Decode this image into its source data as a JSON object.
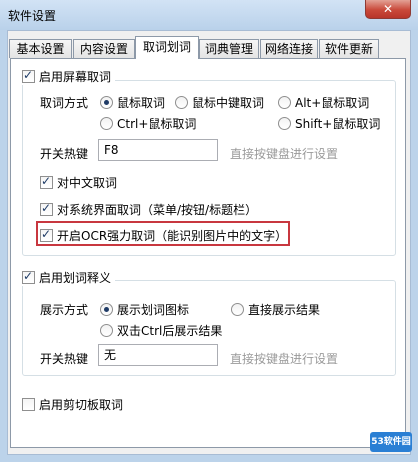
{
  "window": {
    "title": "软件设置",
    "close_glyph": "✕"
  },
  "tabs": [
    {
      "label": "基本设置"
    },
    {
      "label": "内容设置"
    },
    {
      "label": "取词划词"
    },
    {
      "label": "词典管理"
    },
    {
      "label": "网络连接"
    },
    {
      "label": "软件更新"
    }
  ],
  "screen_capture": {
    "enable_label": "启用屏幕取词",
    "method_label": "取词方式",
    "options": [
      {
        "label": "鼠标取词",
        "selected": true
      },
      {
        "label": "鼠标中键取词",
        "selected": false
      },
      {
        "label": "Alt+鼠标取词",
        "selected": false
      },
      {
        "label": "Ctrl+鼠标取词",
        "selected": false
      },
      {
        "label": "Shift+鼠标取词",
        "selected": false
      }
    ],
    "hotkey_label": "开关热键",
    "hotkey_value": "F8",
    "hotkey_hint": "直接按键盘进行设置",
    "chinese_label": "对中文取词",
    "system_ui_label": "对系统界面取词（菜单/按钮/标题栏）",
    "ocr_label": "开启OCR强力取词（能识别图片中的文字）"
  },
  "selection": {
    "enable_label": "启用划词释义",
    "method_label": "展示方式",
    "options": [
      {
        "label": "展示划词图标",
        "selected": true
      },
      {
        "label": "直接展示结果",
        "selected": false
      },
      {
        "label": "双击Ctrl后展示结果",
        "selected": false
      }
    ],
    "hotkey_label": "开关热键",
    "hotkey_value": "无",
    "hotkey_hint": "直接按键盘进行设置"
  },
  "clipboard": {
    "enable_label": "启用剪切板取词"
  },
  "watermark": "53软件园",
  "colors": {
    "highlight_border": "#c8373f",
    "title_bar": "#bcd3ea"
  },
  "icons": {
    "checkbox_check": "check-icon",
    "radio_dot": "radio-dot-icon",
    "close": "close-icon"
  }
}
